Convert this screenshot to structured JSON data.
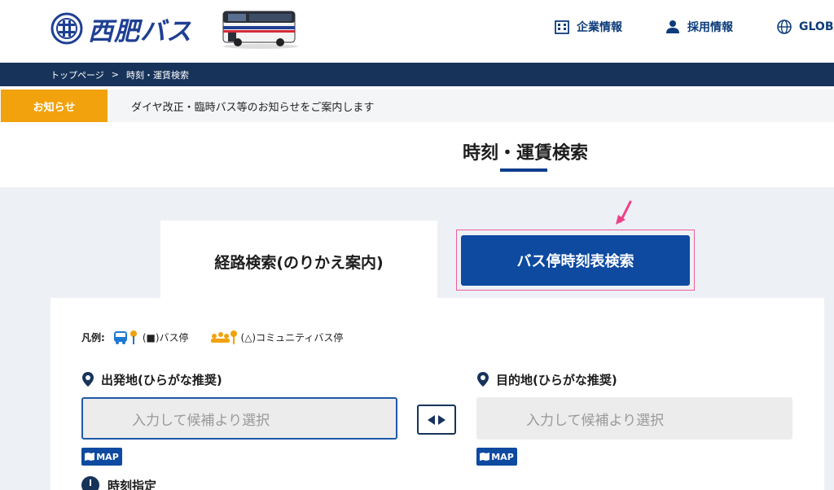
{
  "header": {
    "logo_text": "西肥バス",
    "nav": [
      {
        "label": "企業情報",
        "icon": "building-icon"
      },
      {
        "label": "採用情報",
        "icon": "person-icon"
      },
      {
        "label": "GLOBA",
        "icon": "globe-icon"
      }
    ]
  },
  "breadcrumb": {
    "home": "トップページ",
    "separator": ">",
    "current": "時刻・運賃検索"
  },
  "notice": {
    "label": "お知らせ",
    "text": "ダイヤ改正・臨時バス等のお知らせをご案内します"
  },
  "page": {
    "title": "時刻・運賃検索"
  },
  "tabs": {
    "route_search": "経路検索(のりかえ案内)",
    "timetable_search": "バス停時刻表検索"
  },
  "legend": {
    "prefix": "凡例:",
    "bus_stop": "(■)バス停",
    "community_bus_stop": "(△)コミュニティバス停"
  },
  "form": {
    "from_label": "出発地(ひらがな推奨)",
    "to_label": "目的地(ひらがな推奨)",
    "from_placeholder": "入力して候補より選択",
    "to_placeholder": "入力して候補より選択",
    "map_label": "MAP",
    "time_label": "時刻指定"
  },
  "colors": {
    "brand_navy": "#17335a",
    "brand_blue": "#0d4aa0",
    "notice_orange": "#f2a20d",
    "highlight_pink": "#ee5f98"
  }
}
